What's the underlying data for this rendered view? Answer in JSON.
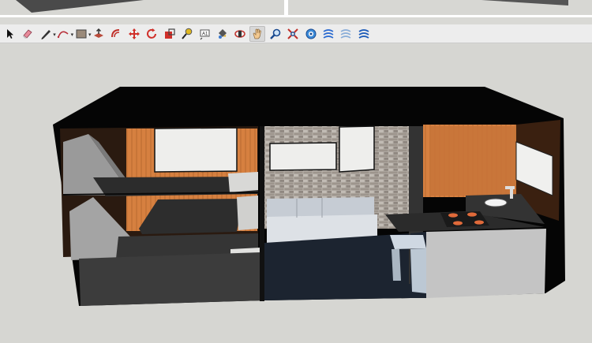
{
  "toolbar": {
    "tools": [
      {
        "icon": "select-arrow-icon",
        "active": false
      },
      {
        "icon": "eraser-icon",
        "active": false
      },
      {
        "icon": "pencil-line-icon",
        "active": false,
        "dropdown": true
      },
      {
        "icon": "arc-icon",
        "active": false,
        "dropdown": true
      },
      {
        "icon": "rectangle-shape-icon",
        "active": false,
        "dropdown": true
      },
      {
        "icon": "push-pull-icon",
        "active": false
      },
      {
        "icon": "offset-icon",
        "active": false
      },
      {
        "icon": "move-icon",
        "active": false
      },
      {
        "icon": "rotate-icon",
        "active": false
      },
      {
        "icon": "scale-icon",
        "active": false
      },
      {
        "icon": "tape-measure-icon",
        "active": false
      },
      {
        "icon": "text-icon",
        "active": false
      },
      {
        "icon": "paint-bucket-icon",
        "active": false
      },
      {
        "icon": "orbit-icon",
        "active": false
      },
      {
        "icon": "pan-icon",
        "active": true
      },
      {
        "icon": "zoom-icon",
        "active": false
      },
      {
        "icon": "zoom-extents-icon",
        "active": false
      },
      {
        "icon": "geo-location-icon",
        "active": false
      },
      {
        "icon": "warehouse-icon",
        "active": false
      },
      {
        "icon": "extension-warehouse-icon",
        "active": false
      },
      {
        "icon": "share-model-icon",
        "active": false
      }
    ]
  },
  "colors": {
    "toolbar_bg": "#ededed",
    "viewport_bg": "#d6d6d2",
    "shell": "#050505",
    "wood": "#d37a3e",
    "brick": "#a9a39c",
    "floor_dark": "#1c2430",
    "cabinet": "#c4c4c4",
    "counter": "#2b2b2b"
  }
}
